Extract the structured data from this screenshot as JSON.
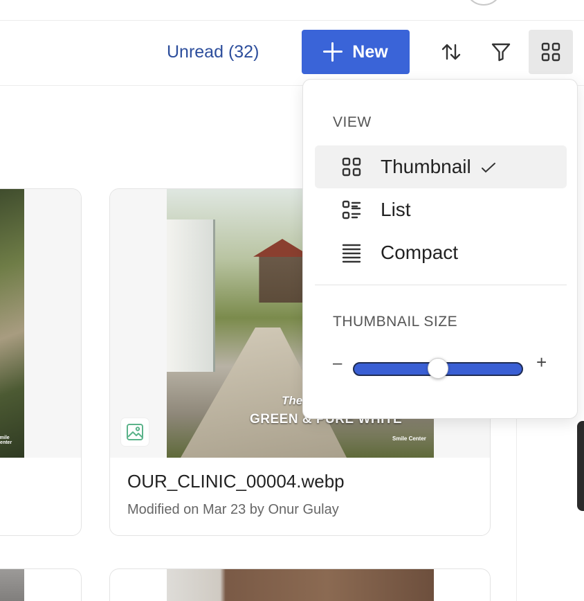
{
  "toolbar": {
    "unread_label": "Unread (32)",
    "new_label": "New",
    "icons": [
      "plus-icon",
      "sort-icon",
      "filter-icon",
      "grid-view-icon"
    ]
  },
  "files": [
    {
      "name": "OUR_CLINIC_00004.webp",
      "meta": "Modified on Mar 23 by Onur Gulay",
      "thumbnail_caption_top": "The",
      "thumbnail_caption": "GREEN & PURE WHITE",
      "thumbnail_brand": "Smile Center"
    }
  ],
  "partial_card": {
    "thumbnail_brand": "Smile Center"
  },
  "view_menu": {
    "view_heading": "VIEW",
    "items": [
      {
        "label": "Thumbnail",
        "icon": "thumbnail-view-icon",
        "selected": true
      },
      {
        "label": "List",
        "icon": "list-view-icon",
        "selected": false
      },
      {
        "label": "Compact",
        "icon": "compact-view-icon",
        "selected": false
      }
    ],
    "size_heading": "THUMBNAIL SIZE",
    "size_minus": "–",
    "size_plus": "+",
    "size_level": 0.5
  },
  "colors": {
    "accent": "#3a64d8",
    "unread_text": "#2d4e9c",
    "slider_fill": "#3a5fd4"
  }
}
